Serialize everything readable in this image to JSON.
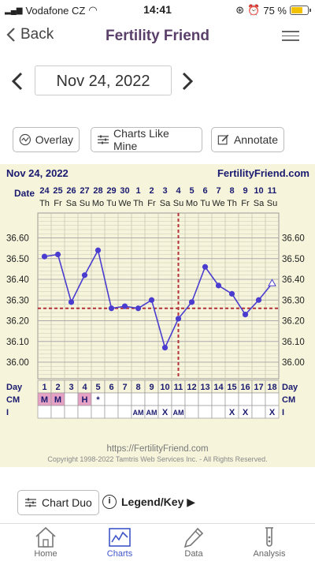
{
  "status_bar": {
    "carrier": "Vodafone CZ",
    "time": "14:41",
    "battery": "75 %",
    "battery_level": 0.75
  },
  "navbar": {
    "back_label": "Back",
    "title": "Fertility Friend"
  },
  "date_selector": {
    "date": "Nov 24, 2022"
  },
  "toolbar": {
    "overlay": "Overlay",
    "charts_like_mine": "Charts Like Mine",
    "annotate": "Annotate"
  },
  "chart_data": {
    "type": "line",
    "title": "Nov 24, 2022",
    "brand": "FertilityFriend.com",
    "date_label": "Date",
    "dates": [
      "24",
      "25",
      "26",
      "27",
      "28",
      "29",
      "30",
      "1",
      "2",
      "3",
      "4",
      "5",
      "6",
      "7",
      "8",
      "9",
      "10",
      "11"
    ],
    "weekdays": [
      "Th",
      "Fr",
      "Sa",
      "Su",
      "Mo",
      "Tu",
      "We",
      "Th",
      "Fr",
      "Sa",
      "Su",
      "Mo",
      "Tu",
      "We",
      "Th",
      "Fr",
      "Sa",
      "Su"
    ],
    "y_ticks": [
      "36.60",
      "36.50",
      "36.40",
      "36.30",
      "36.20",
      "36.10",
      "36.00"
    ],
    "ylim": [
      35.92,
      36.72
    ],
    "temperatures": [
      36.51,
      36.52,
      36.29,
      36.42,
      36.54,
      36.26,
      36.27,
      36.26,
      36.3,
      36.07,
      36.21,
      36.29,
      36.46,
      36.37,
      36.33,
      36.23,
      36.3,
      36.38
    ],
    "last_point_open": true,
    "coverline": 36.26,
    "ovulation_day": 11,
    "day_label": "Day",
    "days": [
      "1",
      "2",
      "3",
      "4",
      "5",
      "6",
      "7",
      "8",
      "9",
      "10",
      "11",
      "12",
      "13",
      "14",
      "15",
      "16",
      "17",
      "18"
    ],
    "cm_label": "CM",
    "cm": [
      "M",
      "M",
      "",
      "H",
      "*",
      "",
      "",
      "",
      "",
      "",
      "",
      "",
      "",
      "",
      "",
      "",
      "",
      ""
    ],
    "i_label": "I",
    "intercourse": [
      "",
      "",
      "",
      "",
      "",
      "",
      "",
      "AM",
      "AM",
      "X",
      "AM",
      "",
      "",
      "",
      "X",
      "X",
      "",
      "X"
    ],
    "grid": true,
    "url": "https://FertilityFriend.com",
    "copyright": "Copyright 1998-2022 Tamtris Web Services Inc. - All Rights Reserved.",
    "colors": {
      "line": "#4a3ccf",
      "coverline": "#b3313a",
      "background": "#f6f5dc",
      "grid": "#c8c7b0",
      "cm_highlight": "#e6a2c4"
    }
  },
  "bottom": {
    "chart_duo": "Chart Duo",
    "legend": "Legend/Key ▶"
  },
  "tabbar": {
    "tabs": [
      {
        "label": "Home",
        "icon": "home-icon"
      },
      {
        "label": "Charts",
        "icon": "chart-icon"
      },
      {
        "label": "Data",
        "icon": "pencil-icon"
      },
      {
        "label": "Analysis",
        "icon": "test-tube-icon"
      }
    ],
    "active": "Charts",
    "accent": "#3e55c9"
  }
}
